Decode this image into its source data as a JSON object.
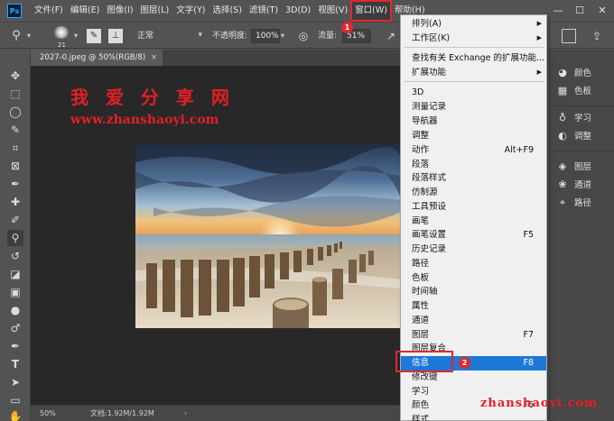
{
  "app": {
    "logo": "Ps"
  },
  "menubar": {
    "items": [
      "文件(F)",
      "编辑(E)",
      "图像(I)",
      "图层(L)",
      "文字(Y)",
      "选择(S)",
      "滤镜(T)",
      "3D(D)",
      "视图(V)",
      "窗口(W)",
      "帮助(H)"
    ],
    "active": "窗口(W)"
  },
  "options": {
    "brush_size": "21",
    "mode": "正常",
    "opacity_label": "不透明度:",
    "opacity_value": "100%",
    "flow_label": "流量:",
    "flow_value": "51%"
  },
  "document": {
    "tab_title": "2027-0.jpeg @ 50%(RGB/8)",
    "tab_close": "×",
    "zoom": "50%",
    "doc_info": "文档:1.92M/1.92M"
  },
  "watermark": {
    "cn": "我 爱 分 享 网",
    "url": "www.zhanshaoyi.com",
    "corner": "zhanshaoyi.com"
  },
  "right_panel": {
    "group1": [
      {
        "label": "颜色",
        "icon": "palette-icon"
      },
      {
        "label": "色板",
        "icon": "swatches-icon"
      }
    ],
    "group2": [
      {
        "label": "学习",
        "icon": "lightbulb-icon"
      },
      {
        "label": "调整",
        "icon": "adjust-icon"
      }
    ],
    "group3": [
      {
        "label": "图层",
        "icon": "layers-icon"
      },
      {
        "label": "通道",
        "icon": "channels-icon"
      },
      {
        "label": "路径",
        "icon": "paths-icon"
      }
    ]
  },
  "window_menu": {
    "items": [
      {
        "label": "排列(A)",
        "shortcut": "",
        "submenu": true
      },
      {
        "label": "工作区(K)",
        "shortcut": "",
        "submenu": true
      },
      {
        "label": "查找有关 Exchange 的扩展功能...",
        "shortcut": "",
        "submenu": false
      },
      {
        "label": "扩展功能",
        "shortcut": "",
        "submenu": true
      },
      {
        "label": "3D",
        "shortcut": ""
      },
      {
        "label": "测量记录",
        "shortcut": ""
      },
      {
        "label": "导航器",
        "shortcut": ""
      },
      {
        "label": "调整",
        "shortcut": ""
      },
      {
        "label": "动作",
        "shortcut": "Alt+F9"
      },
      {
        "label": "段落",
        "shortcut": ""
      },
      {
        "label": "段落样式",
        "shortcut": ""
      },
      {
        "label": "仿制源",
        "shortcut": ""
      },
      {
        "label": "工具预设",
        "shortcut": ""
      },
      {
        "label": "画笔",
        "shortcut": ""
      },
      {
        "label": "画笔设置",
        "shortcut": "F5"
      },
      {
        "label": "历史记录",
        "shortcut": ""
      },
      {
        "label": "路径",
        "shortcut": ""
      },
      {
        "label": "色板",
        "shortcut": ""
      },
      {
        "label": "时间轴",
        "shortcut": ""
      },
      {
        "label": "属性",
        "shortcut": ""
      },
      {
        "label": "通道",
        "shortcut": ""
      },
      {
        "label": "图层",
        "shortcut": "F7"
      },
      {
        "label": "图层复合",
        "shortcut": ""
      },
      {
        "label": "信息",
        "shortcut": "F8",
        "highlighted": true
      },
      {
        "label": "修改键",
        "shortcut": ""
      },
      {
        "label": "学习",
        "shortcut": ""
      },
      {
        "label": "颜色",
        "shortcut": "F6"
      },
      {
        "label": "样式",
        "shortcut": ""
      }
    ]
  },
  "annotations": {
    "badge1": "1",
    "badge2": "2"
  },
  "colors": {
    "accent_red": "#e0282e",
    "highlight_blue": "#1e78d7",
    "chrome_gray": "#535353"
  }
}
